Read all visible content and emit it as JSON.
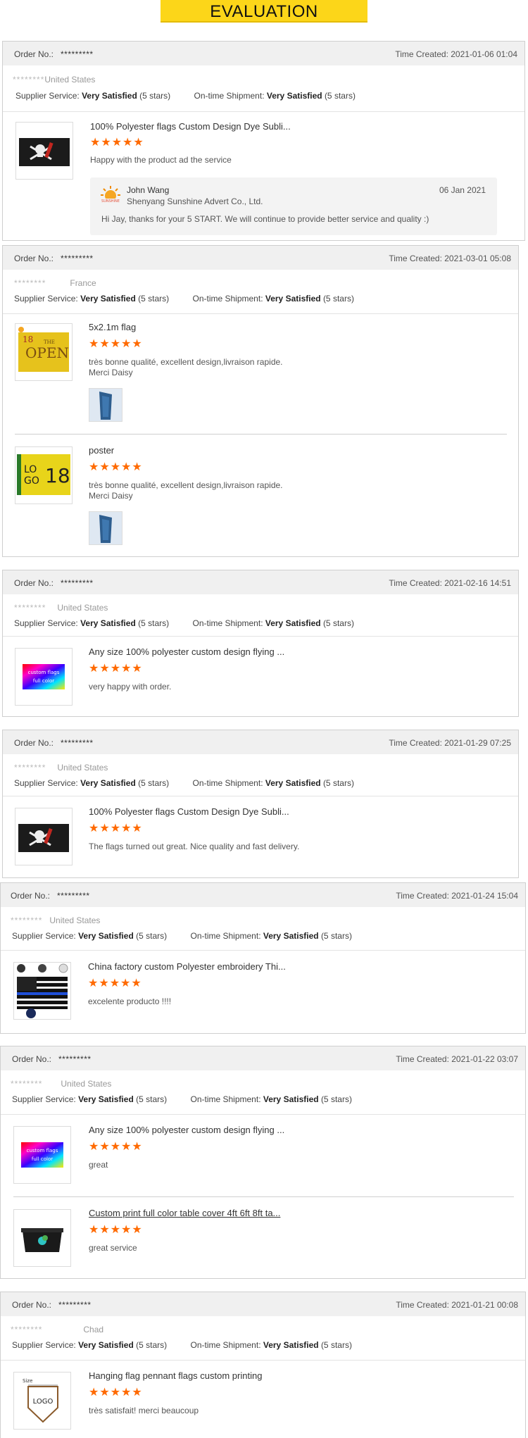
{
  "page": {
    "title": "EVALUATION"
  },
  "labels": {
    "order_no": "Order No.:",
    "time_created_prefix": "Time Created:",
    "supplier_service": "Supplier Service:",
    "ontime_shipment": "On-time Shipment:",
    "rating_word": "Very Satisfied",
    "rating_stars_text": "(5 stars)",
    "stars": "★★★★★"
  },
  "colors": {
    "accent_yellow": "#fcd619",
    "star_orange": "#ff6a00"
  },
  "reviews": [
    {
      "order_no": "*********",
      "time_created": "Time Created: 2021-01-06 01:04",
      "buyer_mask": "********",
      "country": "United States",
      "products": [
        {
          "name": "100% Polyester flags Custom Design Dye Subli...",
          "image": "pirate-flag",
          "comment": "Happy with the product ad the service"
        }
      ],
      "reply": {
        "name": "John Wang",
        "company": "Shenyang Sunshine Advert Co., Ltd.",
        "date": "06 Jan 2021",
        "text": "Hi Jay, thanks for your 5 START. We will continue to provide better service and quality :)"
      }
    },
    {
      "order_no": "*********",
      "time_created": "Time Created: 2021-03-01 05:08",
      "buyer_mask": "********",
      "country": "France",
      "products": [
        {
          "name": "5x2.1m flag",
          "image": "open-flag",
          "comment": "très bonne qualité, excellent design,livraison rapide.\n Merci Daisy"
        },
        {
          "name": "poster",
          "image": "logo18-flag",
          "comment": "très bonne qualité, excellent design,livraison rapide.\n Merci Daisy"
        }
      ]
    },
    {
      "order_no": "*********",
      "time_created": "Time Created: 2021-02-16 14:51",
      "buyer_mask": "********",
      "country": "United States",
      "products": [
        {
          "name": "Any size 100% polyester custom design flying ...",
          "image": "rainbow-flag",
          "image_text": "custom flags\nfull color",
          "comment": "very happy with order."
        }
      ]
    },
    {
      "order_no": "*********",
      "time_created": "Time Created: 2021-01-29 07:25",
      "buyer_mask": "********",
      "country": "United States",
      "products": [
        {
          "name": "100% Polyester flags Custom Design Dye Subli...",
          "image": "pirate-flag",
          "comment": "The flags turned out great.  Nice quality and fast delivery."
        }
      ]
    },
    {
      "order_no": "*********",
      "time_created": "Time Created: 2021-01-24 15:04",
      "buyer_mask": "********",
      "country": "United States",
      "products": [
        {
          "name": "China factory custom Polyester embroidery Thi...",
          "image": "thin-blue-line-flag",
          "comment": "excelente producto !!!!"
        }
      ]
    },
    {
      "order_no": "*********",
      "time_created": "Time Created: 2021-01-22 03:07",
      "buyer_mask": "********",
      "country": "United States",
      "products": [
        {
          "name": "Any size 100% polyester custom design flying ...",
          "image": "rainbow-flag",
          "image_text": "custom flags\nfull color",
          "comment": "great"
        },
        {
          "name": "Custom print full color table cover 4ft 6ft 8ft ta...",
          "image": "table-cover",
          "comment": "great service"
        }
      ]
    },
    {
      "order_no": "*********",
      "time_created": "Time Created: 2021-01-21 00:08",
      "buyer_mask": "********",
      "country": "Chad",
      "products": [
        {
          "name": "Hanging flag pennant flags custom printing",
          "image": "pennant",
          "image_text": "LOGO",
          "image_size_label": "Size",
          "comment": "très satisfait! merci beaucoup"
        }
      ]
    }
  ]
}
